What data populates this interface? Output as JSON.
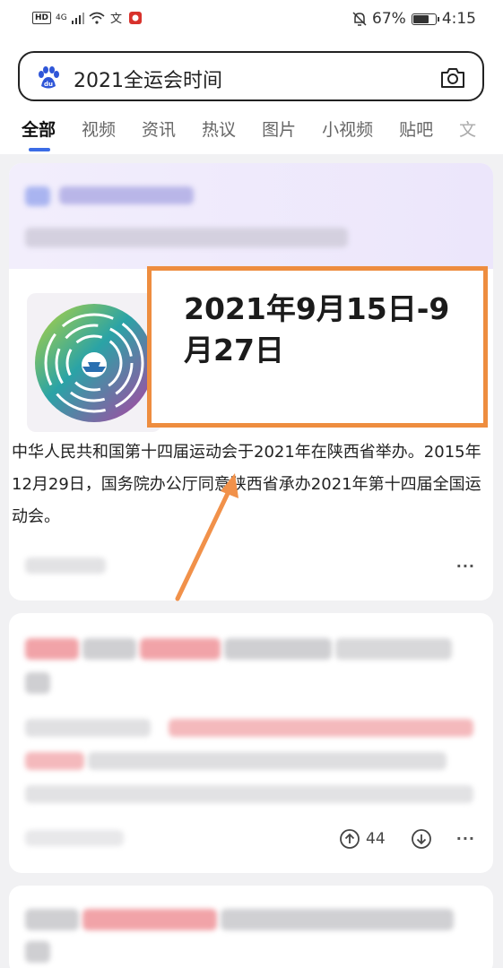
{
  "status_bar": {
    "left": [
      "HD",
      "4G"
    ],
    "battery": "67%",
    "time": "4:15"
  },
  "search": {
    "query": "2021全运会时间",
    "logo_icon": "baidu-paw-icon",
    "camera_icon": "camera-icon"
  },
  "tabs": [
    "全部",
    "视频",
    "资讯",
    "热议",
    "图片",
    "小视频",
    "贴吧",
    "文"
  ],
  "result": {
    "answer": "2021年9月15日-9月27日",
    "description": "中华人民共和国第十四届运动会于2021年在陕西省举办。2015年12月29日，国务院办公厅同意陕西省承办2021年第十四届全国运动会。",
    "more": "···"
  },
  "second_result": {
    "vote_count": "44",
    "more": "···"
  },
  "colors": {
    "accent": "#3b6ce6",
    "highlight_border": "#ee8d3f",
    "blurred_red": "#f1a3a8"
  }
}
